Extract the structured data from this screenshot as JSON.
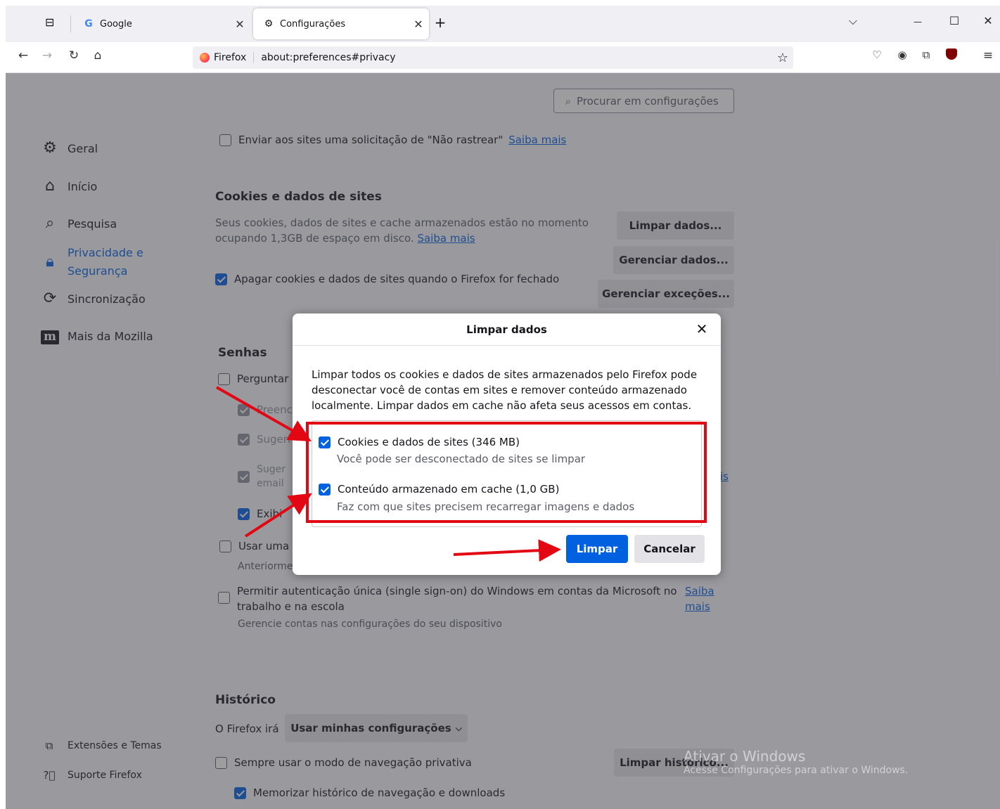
{
  "tabs": [
    {
      "label": "Google",
      "icon": "G"
    },
    {
      "label": "Configurações",
      "icon": "⚙"
    }
  ],
  "window_controls": {
    "list": "⌵",
    "minimize": "—",
    "maximize": "☐",
    "close": "✕"
  },
  "navbar": {
    "identity_label": "Firefox",
    "url": "about:preferences#privacy"
  },
  "search": {
    "placeholder": "Procurar em configurações"
  },
  "sidebar": {
    "items": [
      {
        "label": "Geral",
        "icon": "gear-icon"
      },
      {
        "label": "Início",
        "icon": "home-icon"
      },
      {
        "label": "Pesquisa",
        "icon": "search-icon"
      },
      {
        "label": "Privacidade e Segurança",
        "icon": "lock-icon",
        "line1": "Privacidade e",
        "line2": "Segurança"
      },
      {
        "label": "Sincronização",
        "icon": "sync-icon"
      },
      {
        "label": "Mais da Mozilla",
        "icon": "mozilla-icon",
        "badge": "m"
      }
    ],
    "footer": [
      {
        "label": "Extensões e Temas",
        "icon": "puzzle-icon"
      },
      {
        "label": "Suporte Firefox",
        "icon": "help-icon"
      }
    ]
  },
  "settings": {
    "dnt_label": "Enviar aos sites uma solicitação de \"Não rastrear\"",
    "learn_more": "Saiba mais",
    "cookies_heading": "Cookies e dados de sites",
    "cookies_desc_1": "Seus cookies, dados de sites e cache armazenados estão no momento",
    "cookies_desc_2": "ocupando 1,3GB de espaço em disco.",
    "clear_data_button": "Limpar dados...",
    "manage_data_button": "Gerenciar dados...",
    "manage_exceptions_button": "Gerenciar exceções...",
    "delete_on_close_label": "Apagar cookies e dados de sites quando o Firefox for fechado",
    "passwords_heading": "Senhas",
    "ask_save_label": "Perguntar s",
    "autofill_label": "Preenc",
    "suggest_label": "Sugeri",
    "suggest2_label": "Suger",
    "email_label": "email",
    "show_label": "Exibi",
    "primary_password_label": "Usar uma s",
    "formerly_label": "Anteriorme",
    "sso_label_1": "Permitir autenticação única (single sign-on) do Windows em contas da Microsoft no",
    "sso_label_2": "trabalho e na escola",
    "sso_learn_1": "Saiba",
    "sso_learn_2": "mais",
    "sso_desc": "Gerencie contas nas configurações do seu dispositivo",
    "side_link_fragment": "is",
    "history_heading": "Histórico",
    "history_will": "O Firefox irá",
    "history_select": "Usar minhas configurações",
    "private_mode_label": "Sempre usar o modo de navegação privativa",
    "clear_history_button": "Limpar histórico...",
    "remember_history_label": "Memorizar histórico de navegação e downloads"
  },
  "dialog": {
    "title": "Limpar dados",
    "description": "Limpar todos os cookies e dados de sites armazenados pelo Firefox pode desconectar você de contas em sites e remover conteúdo armazenado localmente. Limpar dados em cache não afeta seus acessos em contas.",
    "option1_label": "Cookies e dados de sites (346 MB)",
    "option1_sub": "Você pode ser desconectado de sites se limpar",
    "option2_label": "Conteúdo armazenado em cache (1,0 GB)",
    "option2_sub": "Faz com que sites precisem recarregar imagens e dados",
    "clear_button": "Limpar",
    "cancel_button": "Cancelar"
  },
  "watermark": {
    "title": "Ativar o Windows",
    "subtitle": "Acesse Configurações para ativar o Windows."
  },
  "colors": {
    "accent": "#0061e0",
    "annotation": "#e30613"
  }
}
